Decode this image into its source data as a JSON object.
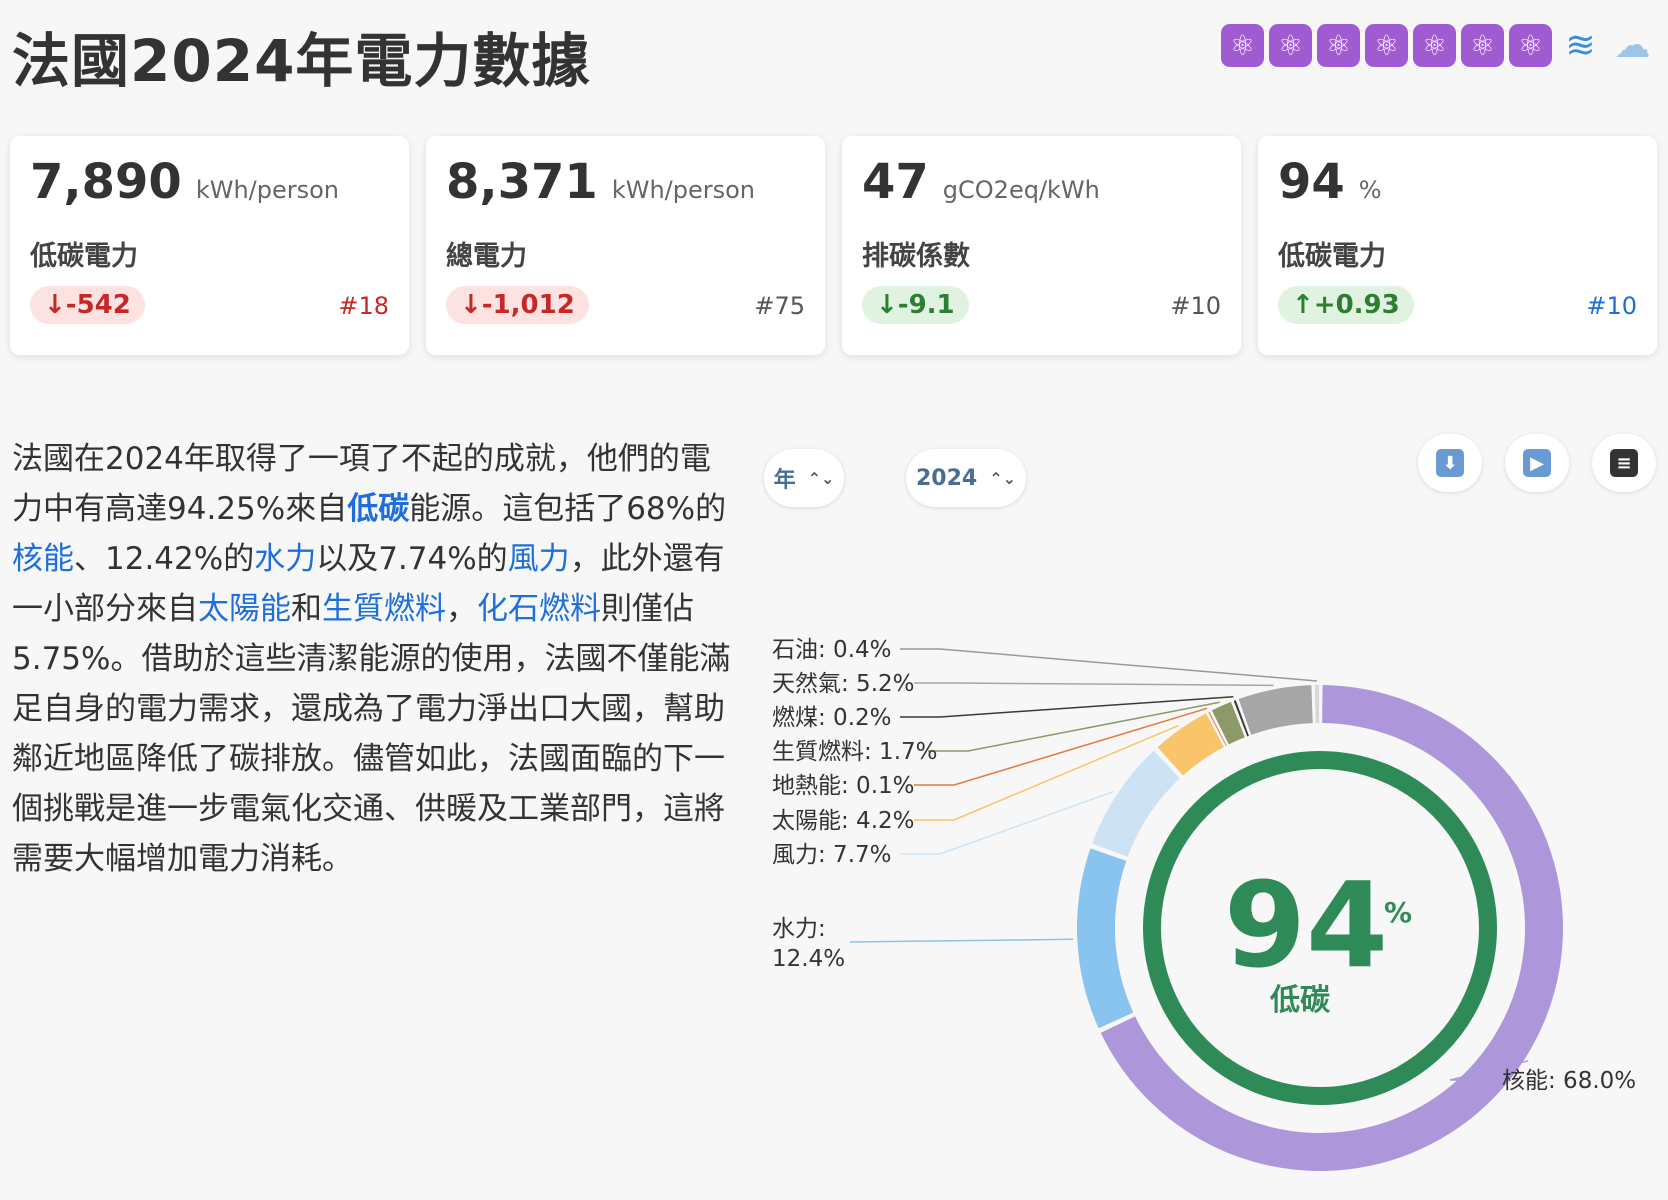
{
  "header": {
    "title": "法國2024年電力數據",
    "flags": [
      {
        "icon": "atom-icon",
        "glyph": "⚛"
      },
      {
        "icon": "atom-icon",
        "glyph": "⚛"
      },
      {
        "icon": "atom-icon",
        "glyph": "⚛"
      },
      {
        "icon": "atom-icon",
        "glyph": "⚛"
      },
      {
        "icon": "atom-icon",
        "glyph": "⚛"
      },
      {
        "icon": "atom-icon",
        "glyph": "⚛"
      },
      {
        "icon": "atom-icon",
        "glyph": "⚛"
      },
      {
        "icon": "wave-icon",
        "glyph": "≋"
      },
      {
        "icon": "wind-icon",
        "glyph": "☁"
      }
    ]
  },
  "cards": [
    {
      "value": "7,890",
      "unit": "kWh/person",
      "label": "低碳電力",
      "change": "↓-542",
      "direction": "down",
      "rank": "#18",
      "rank_color": "#c62828"
    },
    {
      "value": "8,371",
      "unit": "kWh/person",
      "label": "總電力",
      "change": "↓-1,012",
      "direction": "down",
      "rank": "#75",
      "rank_color": "#555555"
    },
    {
      "value": "47",
      "unit": "gCO2eq/kWh",
      "label": "排碳係數",
      "change": "↓-9.1",
      "direction": "up",
      "rank": "#10",
      "rank_color": "#555555"
    },
    {
      "value": "94",
      "unit": "%",
      "label": "低碳電力",
      "change": "↑+0.93",
      "direction": "up",
      "rank": "#10",
      "rank_color": "#1e6fd9"
    }
  ],
  "description": {
    "p1": "法國在2024年取得了一項了不起的成就，他們的電力中有高達94.25%來自",
    "link_lowcarbon": "低碳",
    "p2": "能源。這包括了68%的",
    "link_nuclear": "核能",
    "p3": "、12.42%的",
    "link_hydro": "水力",
    "p4": "以及7.74%的",
    "link_wind": "風力",
    "p5": "，此外還有一小部分來自",
    "link_solar": "太陽能",
    "p6": "和",
    "link_biofuel": "生質燃料",
    "p7": "，",
    "link_fossil": "化石燃料",
    "p8": "則僅佔5.75%。借助於這些清潔能源的使用，法國不僅能滿足自身的電力需求，還成為了電力淨出口大國，幫助鄰近地區降低了碳排放。儘管如此，法國面臨的下一個挑戰是進一步電氣化交通、供暖及工業部門，這將需要大幅增加電力消耗。"
  },
  "controls": {
    "period_label": "年",
    "year_label": "2024",
    "caret": "⌃⌄",
    "download_icon": "download-icon",
    "play_icon": "play-icon",
    "clapper_icon": "clapperboard-icon"
  },
  "chart_data": {
    "type": "pie",
    "style": "donut",
    "center_value": "94",
    "center_unit": "%",
    "center_label": "低碳",
    "low_carbon_share": 94,
    "slices": [
      {
        "name": "核能",
        "value": 68.0,
        "label": "核能: 68.0%",
        "color": "#ae96da"
      },
      {
        "name": "水力",
        "value": 12.4,
        "label": "水力:\n12.4%",
        "color": "#88c4ef"
      },
      {
        "name": "風力",
        "value": 7.7,
        "label": "風力: 7.7%",
        "color": "#cde3f4"
      },
      {
        "name": "太陽能",
        "value": 4.2,
        "label": "太陽能: 4.2%",
        "color": "#f9c46a"
      },
      {
        "name": "地熱能",
        "value": 0.1,
        "label": "地熱能: 0.1%",
        "color": "#e47a3c"
      },
      {
        "name": "生質燃料",
        "value": 1.7,
        "label": "生質燃料: 1.7%",
        "color": "#8b9a68"
      },
      {
        "name": "燃煤",
        "value": 0.2,
        "label": "燃煤: 0.2%",
        "color": "#3a3a3a"
      },
      {
        "name": "天然氣",
        "value": 5.2,
        "label": "天然氣: 5.2%",
        "color": "#a6a6a6"
      },
      {
        "name": "石油",
        "value": 0.4,
        "label": "石油: 0.4%",
        "color": "#d8d8d8"
      }
    ],
    "center_ring_color": "#2e8b57"
  }
}
